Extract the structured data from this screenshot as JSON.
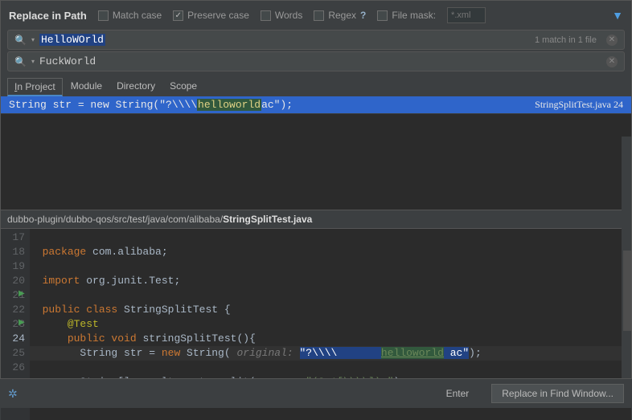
{
  "header": {
    "title": "Replace in Path",
    "options": {
      "match_case": {
        "label": "Match case",
        "checked": false
      },
      "preserve_case": {
        "label": "Preserve case",
        "checked": true
      },
      "words": {
        "label": "Words",
        "checked": false
      },
      "regex": {
        "label": "Regex",
        "checked": false
      },
      "file_mask": {
        "label": "File mask:",
        "checked": false,
        "placeholder": "*.xml"
      }
    }
  },
  "search": {
    "find_value": "HelloWOrld",
    "replace_value": "FuckWorld",
    "match_info": "1 match in 1 file"
  },
  "tabs": {
    "in_project": "In Project",
    "module": "Module",
    "directory": "Directory",
    "scope": "Scope"
  },
  "result": {
    "before": "String str = new String(\"?\\\\\\\\ ",
    "highlight": "helloworld",
    "after": " ac\");",
    "file": "StringSplitTest.java",
    "line": "24"
  },
  "path": {
    "prefix": "dubbo-plugin/dubbo-qos/src/test/java/com/alibaba/",
    "file": "StringSplitTest.java"
  },
  "code": {
    "lines": [
      "17",
      "18",
      "19",
      "20",
      "21",
      "22",
      "23",
      "24",
      "25",
      "26"
    ],
    "l17_kw": "package",
    "l17_rest": " com.alibaba;",
    "l19_kw": "import",
    "l19_rest": " org.junit.Test;",
    "l21_a": "public class",
    "l21_b": " StringSplitTest {",
    "l22": "@Test",
    "l23_a": "public void",
    "l23_b": " stringSplitTest(){",
    "l24_a": "String str = ",
    "l24_new": "new",
    "l24_b": " String(",
    "l24_hint": " original: ",
    "l24_s1": "\"?\\\\\\\\       ",
    "l24_hl": "helloworld",
    "l24_s2": " ac\"",
    "l24_c": ");",
    "l25_a": "String[] result = str.split(",
    "l25_hint": " regex: ",
    "l25_s": "\"(?<![\\\\\\\\]) \"",
    "l25_b": ");",
    "l26": "}"
  },
  "footer": {
    "enter": "Enter",
    "replace": "Replace in Find Window..."
  }
}
